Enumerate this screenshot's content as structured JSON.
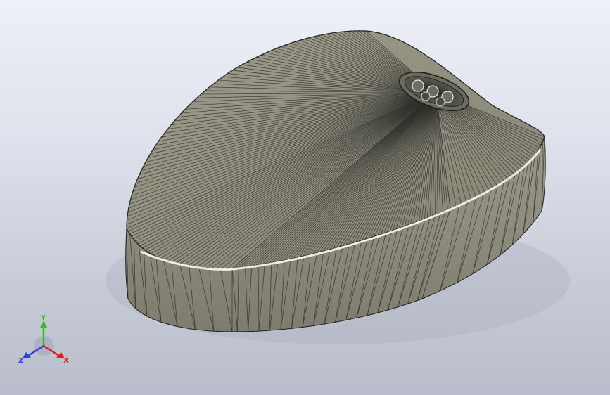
{
  "viewport": {
    "background_top": "#eef0f6",
    "background_bottom": "#b9bcca",
    "model": {
      "fill_color": "#8d8c7c",
      "edge_color": "#1e1e1a",
      "highlight_color": "#f4f4ee"
    },
    "triad": {
      "y_label": "Y",
      "x_label": "X",
      "z_label": "Z",
      "y_color": "#3fb536",
      "x_color": "#d62424",
      "z_color": "#2b3fd6"
    }
  }
}
